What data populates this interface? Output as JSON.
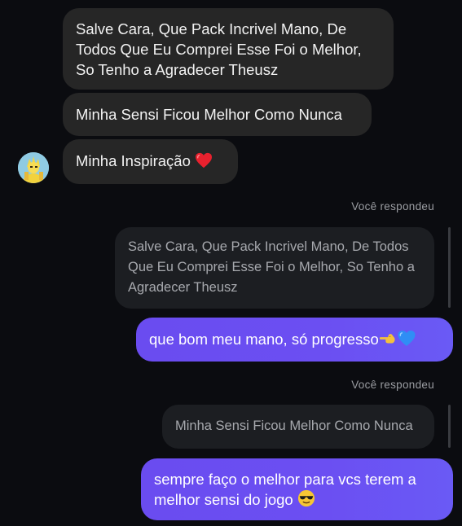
{
  "messages": {
    "incoming_1": "Salve Cara, Que Pack Incrivel Mano, De Todos Que Eu Comprei Esse Foi o Melhor, So Tenho a Agradecer Theusz",
    "incoming_2": "Minha Sensi Ficou Melhor Como Nunca",
    "incoming_3": "Minha Inspiração",
    "reply_label_1": "Você respondeu",
    "quoted_1": "Salve Cara, Que Pack Incrivel Mano, De Todos Que Eu Comprei Esse Foi o Melhor, So Tenho a Agradecer Theusz",
    "outgoing_1": "que bom meu mano, só progresso",
    "reply_label_2": "Você respondeu",
    "quoted_2": "Minha Sensi Ficou Melhor Como Nunca",
    "outgoing_2": "sempre faço o melhor para vcs terem a melhor sensi do jogo"
  },
  "icons": {
    "heart": "red-heart-icon",
    "pointing_hand": "pointing-hand-icon",
    "blue_heart": "blue-heart-icon",
    "sunglasses": "sunglasses-face-icon",
    "avatar": "user-avatar"
  },
  "colors": {
    "background": "#0b0c10",
    "incoming_bubble": "#262626",
    "outgoing_bubble": "#6b4ff2",
    "quoted_bubble": "#1c1e22"
  }
}
